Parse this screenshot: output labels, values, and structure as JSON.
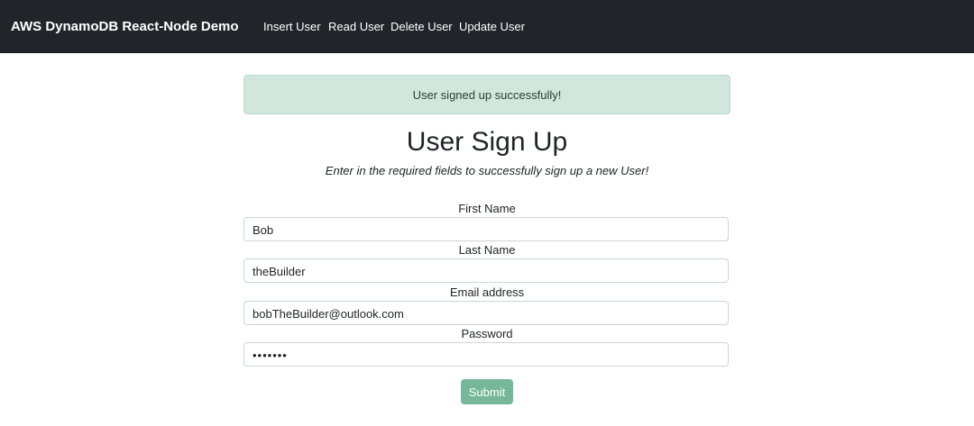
{
  "navbar": {
    "brand": "AWS DynamoDB React-Node Demo",
    "links": [
      "Insert User",
      "Read User",
      "Delete User",
      "Update User"
    ]
  },
  "alert": {
    "message": "User signed up successfully!",
    "color": "#d1e7dd"
  },
  "form": {
    "title": "User Sign Up",
    "subtitle": "Enter in the required fields to successfully sign up a new User!",
    "fields": [
      {
        "label": "First Name",
        "value": "Bob"
      },
      {
        "label": "Last Name",
        "value": "theBuilder"
      },
      {
        "label": "Email address",
        "value": "bobTheBuilder@outlook.com"
      },
      {
        "label": "Password",
        "value": "•••••••"
      }
    ],
    "submit_label": "Submit",
    "submit_color": "#75b798"
  }
}
